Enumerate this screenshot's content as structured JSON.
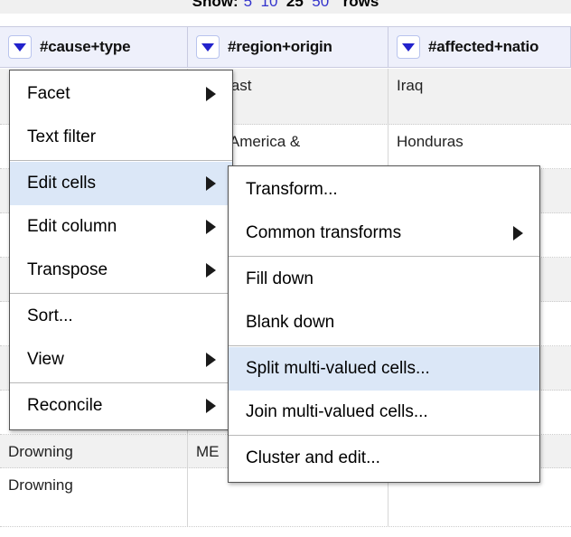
{
  "rows_bar": {
    "label": "Show:",
    "options": [
      {
        "value": "5",
        "selected": false
      },
      {
        "value": "10",
        "selected": false
      },
      {
        "value": "25",
        "selected": true
      },
      {
        "value": "50",
        "selected": false
      }
    ],
    "suffix": "rows"
  },
  "columns": [
    {
      "name": "#cause+type",
      "menu_icon": "chevron-down-icon"
    },
    {
      "name": "#region+origin",
      "menu_icon": "chevron-down-icon"
    },
    {
      "name": "#affected+natio",
      "menu_icon": "chevron-down-icon"
    }
  ],
  "grid": {
    "rows": [
      {
        "c1": "",
        "c2": "dle East",
        "c3": "Iraq"
      },
      {
        "c1": "",
        "c2": "ntral America &",
        "c3": "Honduras"
      },
      {
        "c1": "",
        "c2": "",
        "c3": ""
      },
      {
        "c1": "",
        "c2": "",
        "c3": ""
      },
      {
        "c1": "",
        "c2": "",
        "c3": ""
      },
      {
        "c1": "",
        "c2": "",
        "c3": ""
      },
      {
        "c1": "",
        "c2": "",
        "c3": ""
      },
      {
        "c1": "",
        "c2": "",
        "c3": ""
      },
      {
        "c1": "Drowning",
        "c2": "ME",
        "c3": ""
      },
      {
        "c1": "Drowning",
        "c2": "",
        "c3": ""
      }
    ]
  },
  "main_menu": {
    "items": [
      {
        "label": "Facet",
        "submenu": true,
        "highlighted": false,
        "sep_after": false
      },
      {
        "label": "Text filter",
        "submenu": false,
        "highlighted": false,
        "sep_after": true
      },
      {
        "label": "Edit cells",
        "submenu": true,
        "highlighted": true,
        "sep_after": false
      },
      {
        "label": "Edit column",
        "submenu": true,
        "highlighted": false,
        "sep_after": false
      },
      {
        "label": "Transpose",
        "submenu": true,
        "highlighted": false,
        "sep_after": true
      },
      {
        "label": "Sort...",
        "submenu": false,
        "highlighted": false,
        "sep_after": false
      },
      {
        "label": "View",
        "submenu": true,
        "highlighted": false,
        "sep_after": true
      },
      {
        "label": "Reconcile",
        "submenu": true,
        "highlighted": false,
        "sep_after": false
      }
    ]
  },
  "sub_menu": {
    "items": [
      {
        "label": "Transform...",
        "submenu": false,
        "highlighted": false,
        "sep_after": false
      },
      {
        "label": "Common transforms",
        "submenu": true,
        "highlighted": false,
        "sep_after": true
      },
      {
        "label": "Fill down",
        "submenu": false,
        "highlighted": false,
        "sep_after": false
      },
      {
        "label": "Blank down",
        "submenu": false,
        "highlighted": false,
        "sep_after": true
      },
      {
        "label": "Split multi-valued cells...",
        "submenu": false,
        "highlighted": true,
        "sep_after": false
      },
      {
        "label": "Join multi-valued cells...",
        "submenu": false,
        "highlighted": false,
        "sep_after": true
      },
      {
        "label": "Cluster and edit...",
        "submenu": false,
        "highlighted": false,
        "sep_after": false
      }
    ]
  },
  "colors": {
    "header_band": "#eef0fb",
    "menu_highlight": "#dbe7f7",
    "link_blue": "#3333cc",
    "triangle_blue": "#2222cc",
    "row_stripe": "#f1f1f1"
  }
}
